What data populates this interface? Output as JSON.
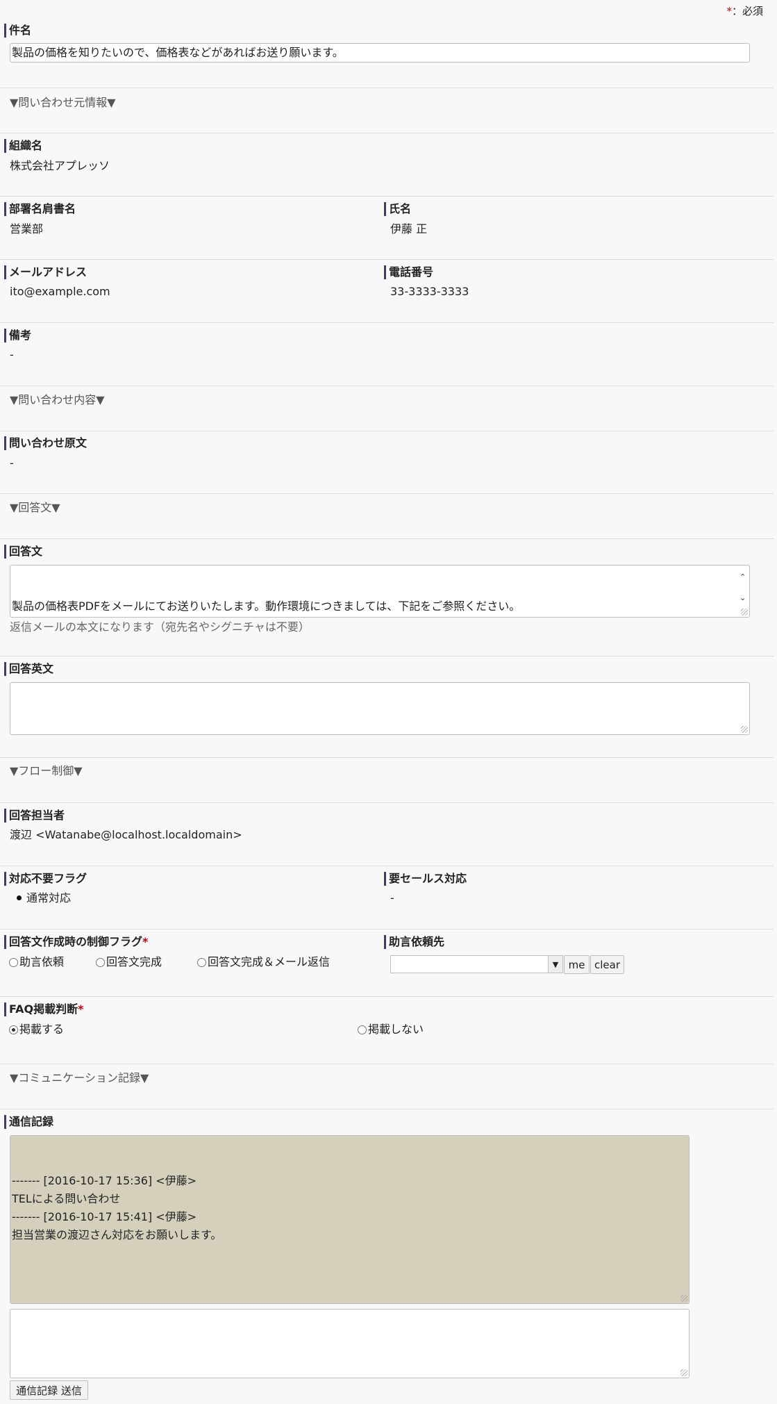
{
  "required_note": {
    "star": "*",
    "text": "：必須"
  },
  "subject": {
    "label": "件名",
    "value": "製品の価格を知りたいので、価格表などがあればお送り願います。"
  },
  "sections": {
    "inquirer": "▼問い合わせ元情報▼",
    "content": "▼問い合わせ内容▼",
    "answer": "▼回答文▼",
    "flow": "▼フロー制御▼",
    "communication": "▼コミュニケーション記録▼"
  },
  "organization": {
    "label": "組織名",
    "value": "株式会社アプレッソ"
  },
  "department": {
    "label": "部署名肩書名",
    "value": "営業部"
  },
  "name": {
    "label": "氏名",
    "value": "伊藤 正"
  },
  "email": {
    "label": "メールアドレス",
    "value": "ito@example.com"
  },
  "phone": {
    "label": "電話番号",
    "value": "33-3333-3333"
  },
  "remarks": {
    "label": "備考",
    "value": "-"
  },
  "original": {
    "label": "問い合わせ原文",
    "value": "-"
  },
  "answer": {
    "label": "回答文",
    "value": "製品の価格表PDFをメールにてお送りいたします。動作環境につきましては、下記をご参照ください。\n動作環境 | DataSpider BPM | アプレッソ\nhttps://www.appresso.com/bpm/specification/",
    "hint": "返信メールの本文になります（宛先名やシグニチャは不要）"
  },
  "answer_en": {
    "label": "回答英文",
    "value": ""
  },
  "assignee": {
    "label": "回答担当者",
    "value": "渡辺 <Watanabe@localhost.localdomain>"
  },
  "no_action_flag": {
    "label": "対応不要フラグ",
    "value": "通常対応"
  },
  "sales_needed": {
    "label": "要セールス対応",
    "value": "-"
  },
  "control_flag": {
    "label": "回答文作成時の制御フラグ",
    "required": "*",
    "options": [
      "助言依頼",
      "回答文完成",
      "回答文完成＆メール返信"
    ]
  },
  "advice_to": {
    "label": "助言依頼先",
    "selected": "",
    "me_label": "me",
    "clear_label": "clear"
  },
  "faq": {
    "label": "FAQ掲載判断",
    "required": "*",
    "options": [
      "掲載する",
      "掲載しない"
    ],
    "selected_index": 0
  },
  "comm_log": {
    "label": "通信記録",
    "value": "------- [2016-10-17 15:36] <伊藤>\nTELによる問い合わせ\n------- [2016-10-17 15:41] <伊藤>\n担当営業の渡辺さん対応をお願いします。",
    "new_entry": "",
    "send_label": "通信記録 送信"
  },
  "colors": {
    "label_bar": "#3e3d64",
    "required": "#cc0000",
    "log_bg": "#d4d0bc"
  }
}
